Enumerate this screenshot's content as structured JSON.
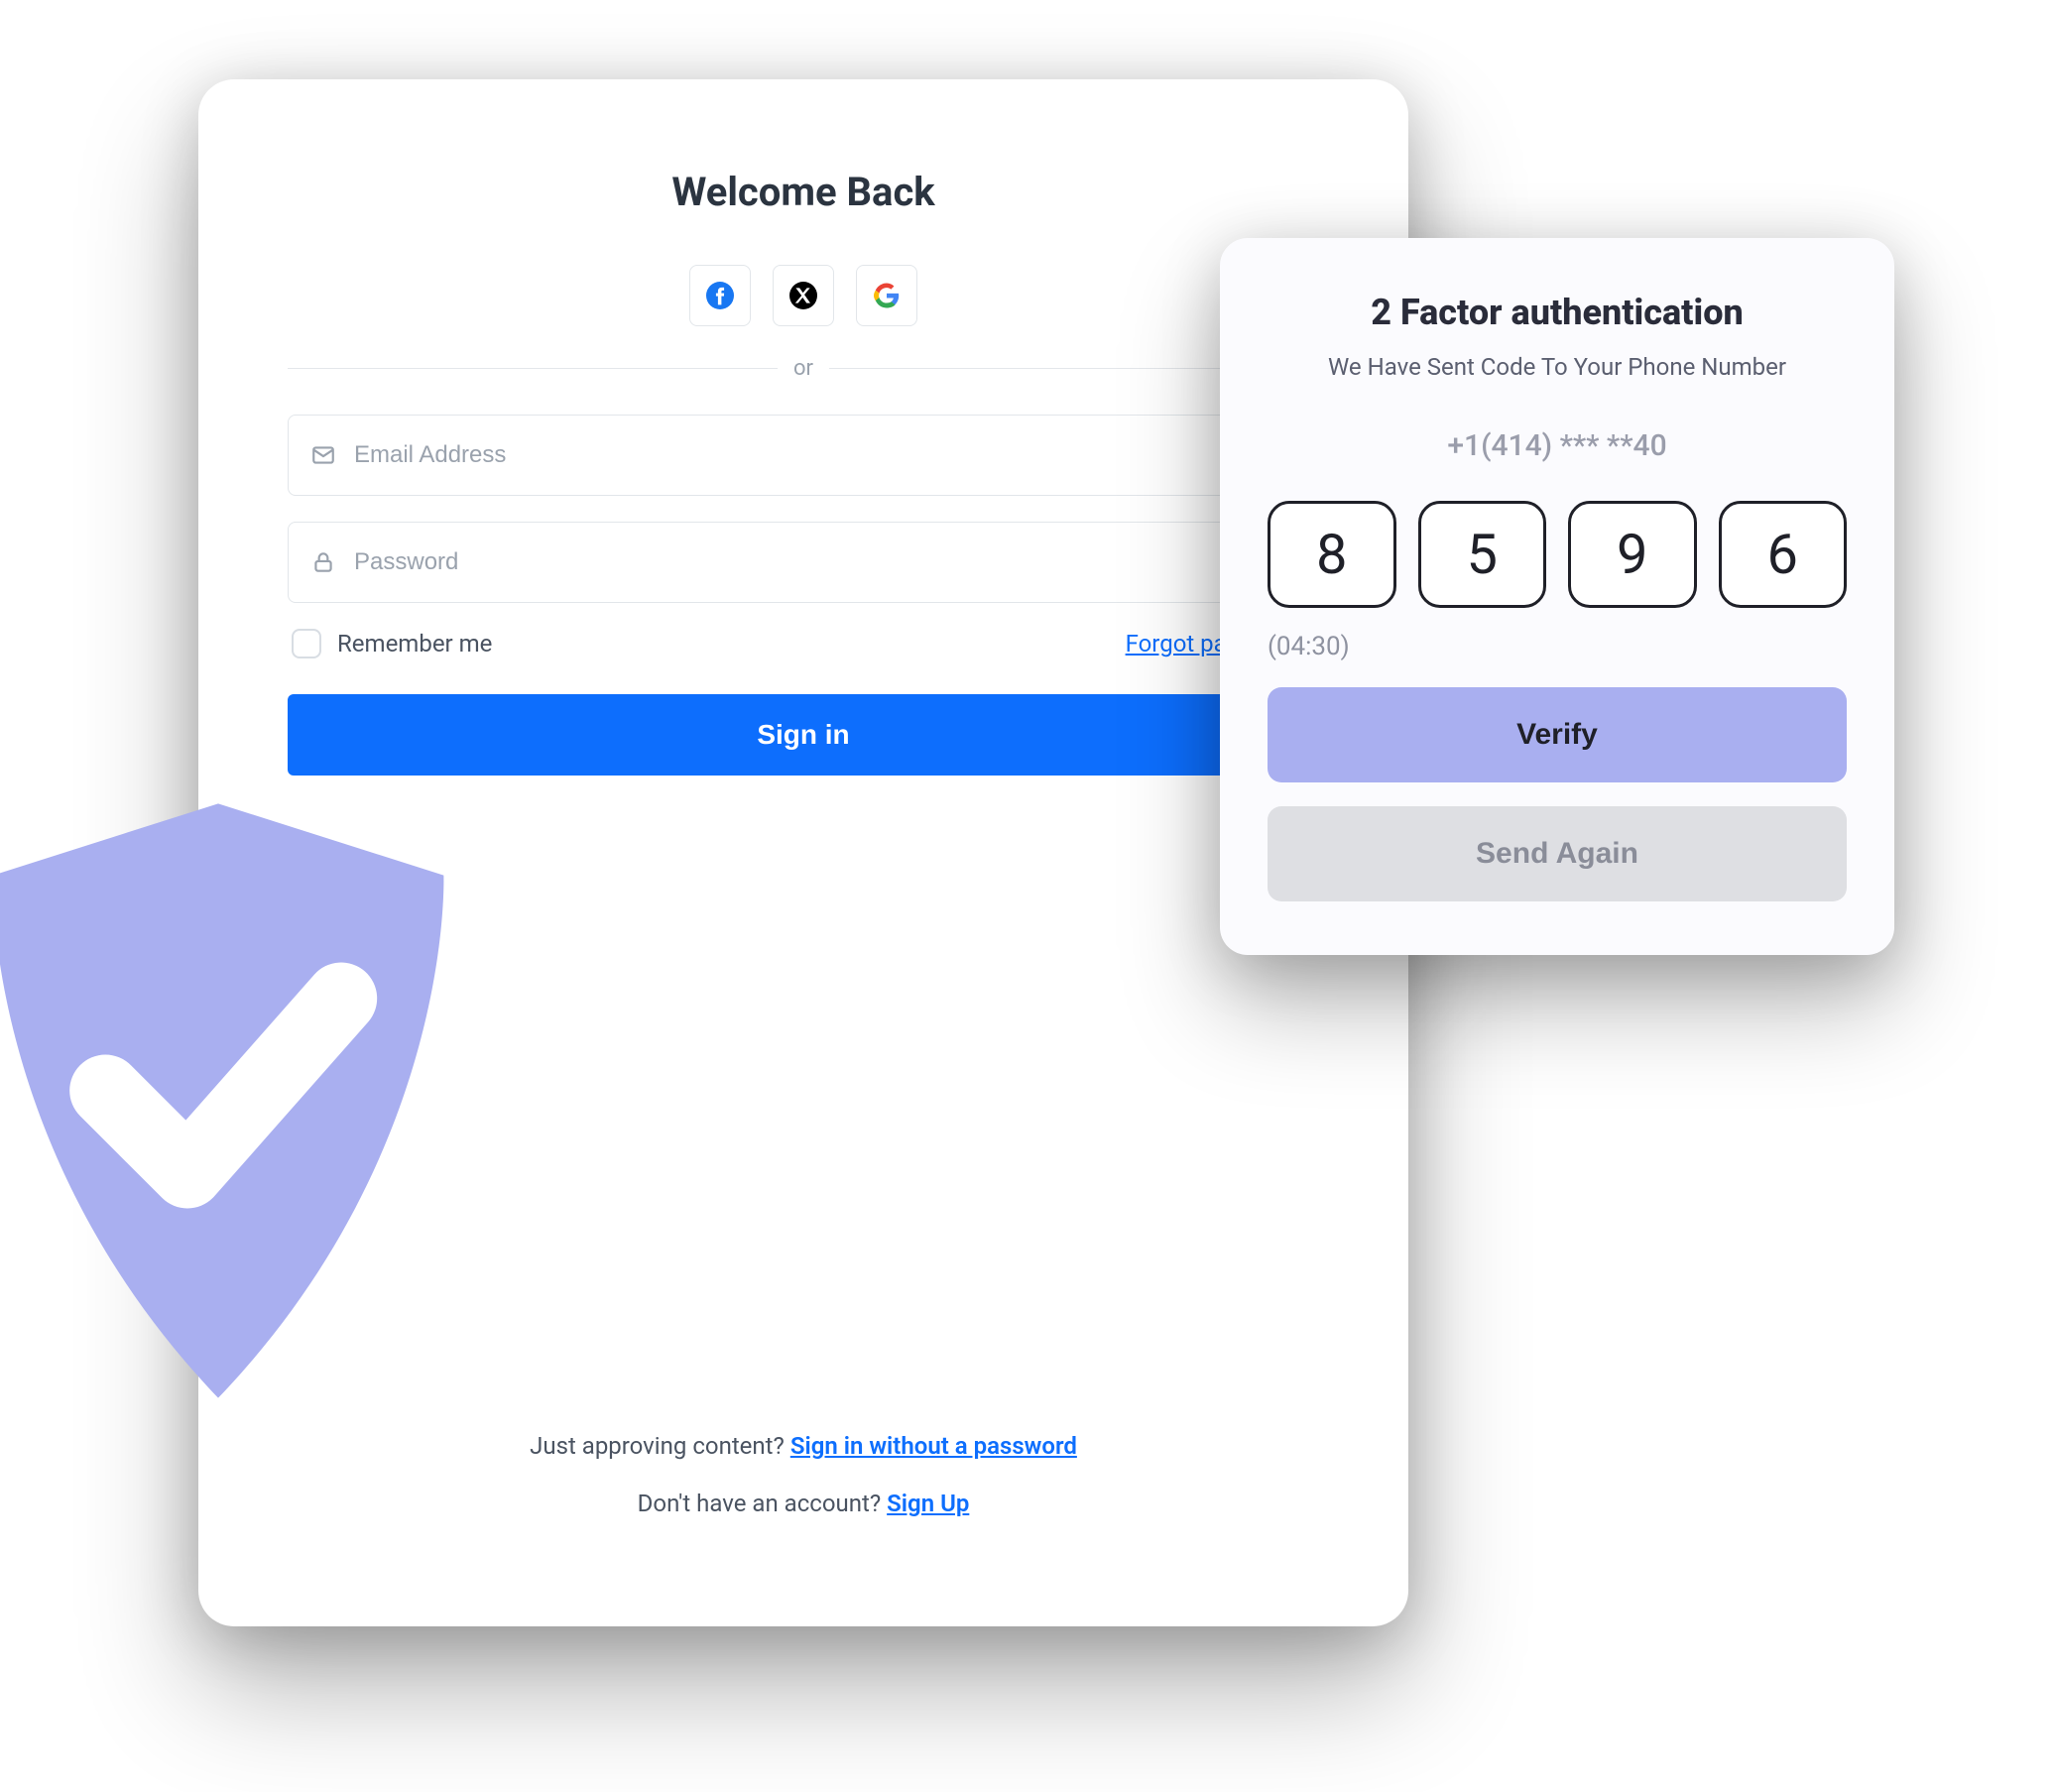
{
  "login": {
    "title": "Welcome Back",
    "social": {
      "facebook": "facebook",
      "x": "x",
      "google": "google"
    },
    "divider_label": "or",
    "email_placeholder": "Email Address",
    "password_placeholder": "Password",
    "remember_label": "Remember me",
    "forgot_label": "Forgot password?",
    "submit_label": "Sign in",
    "footer_approve_text": "Just approving content? ",
    "footer_approve_link": "Sign in without a password",
    "footer_signup_text": "Don't have an account? ",
    "footer_signup_link": "Sign Up"
  },
  "twofa": {
    "title": "2 Factor authentication",
    "subtitle": "We Have Sent Code To Your Phone Number",
    "phone_masked": "+1(414) *** **40",
    "code": [
      "8",
      "5",
      "9",
      "6"
    ],
    "timer": "(04:30)",
    "verify_label": "Verify",
    "resend_label": "Send Again"
  },
  "colors": {
    "primary": "#0d6efd",
    "shield": "#a9aff0",
    "verify_bg": "#a9aff0"
  }
}
